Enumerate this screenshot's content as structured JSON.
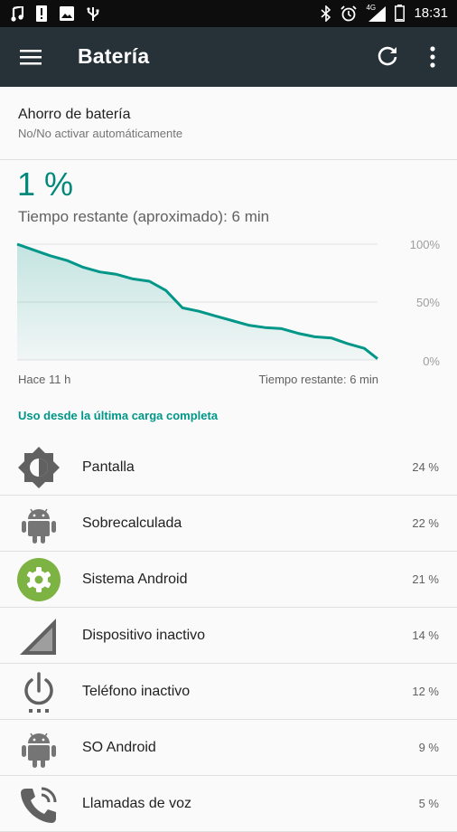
{
  "status_bar": {
    "time": "18:31",
    "network": "4G",
    "left_icons": [
      "music-note-icon",
      "alert-icon",
      "image-icon",
      "usb-icon"
    ],
    "right_icons": [
      "bluetooth-icon",
      "alarm-icon",
      "signal-icon",
      "battery-icon"
    ]
  },
  "toolbar": {
    "title": "Batería",
    "menu_icon": "hamburger-menu-icon",
    "refresh_icon": "refresh-icon",
    "more_icon": "more-vert-icon"
  },
  "battery_saver": {
    "title": "Ahorro de batería",
    "subtitle": "No/No activar automáticamente"
  },
  "battery": {
    "percent": "1 %",
    "remaining": "Tiempo restante (aproximado): 6 min"
  },
  "chart_data": {
    "type": "area",
    "y_tick_labels": [
      "100%",
      "50%",
      "0%"
    ],
    "x_left_label": "Hace 11 h",
    "x_right_label": "Tiempo restante: 6 min",
    "ylim": [
      0,
      100
    ],
    "grid": true,
    "color": "#009688",
    "x": [
      0,
      0.5,
      1,
      1.5,
      2,
      2.5,
      3,
      3.5,
      4,
      4.5,
      5,
      5.5,
      6,
      6.5,
      7,
      7.5,
      8,
      8.5,
      9,
      9.5,
      10,
      10.5,
      10.9
    ],
    "values": [
      100,
      95,
      90,
      86,
      80,
      76,
      74,
      70,
      68,
      60,
      45,
      42,
      38,
      34,
      30,
      28,
      27,
      23,
      20,
      19,
      14,
      10,
      1
    ]
  },
  "usage": {
    "header": "Uso desde la última carga completa",
    "items": [
      {
        "label": "Pantalla",
        "value": "24 %",
        "icon": "brightness-icon"
      },
      {
        "label": "Sobrecalculada",
        "value": "22 %",
        "icon": "android-icon"
      },
      {
        "label": "Sistema Android",
        "value": "21 %",
        "icon": "settings-gear-icon"
      },
      {
        "label": "Dispositivo inactivo",
        "value": "14 %",
        "icon": "signal-bars-icon"
      },
      {
        "label": "Teléfono inactivo",
        "value": "12 %",
        "icon": "power-icon"
      },
      {
        "label": "SO Android",
        "value": "9 %",
        "icon": "android-icon"
      },
      {
        "label": "Llamadas de voz",
        "value": "5 %",
        "icon": "phone-call-icon"
      }
    ]
  },
  "colors": {
    "accent": "#009688",
    "toolbar": "#263238",
    "status_bar": "#0d0d0d",
    "android_icon": "#757575",
    "system_android_icon_bg": "#7cb342"
  }
}
